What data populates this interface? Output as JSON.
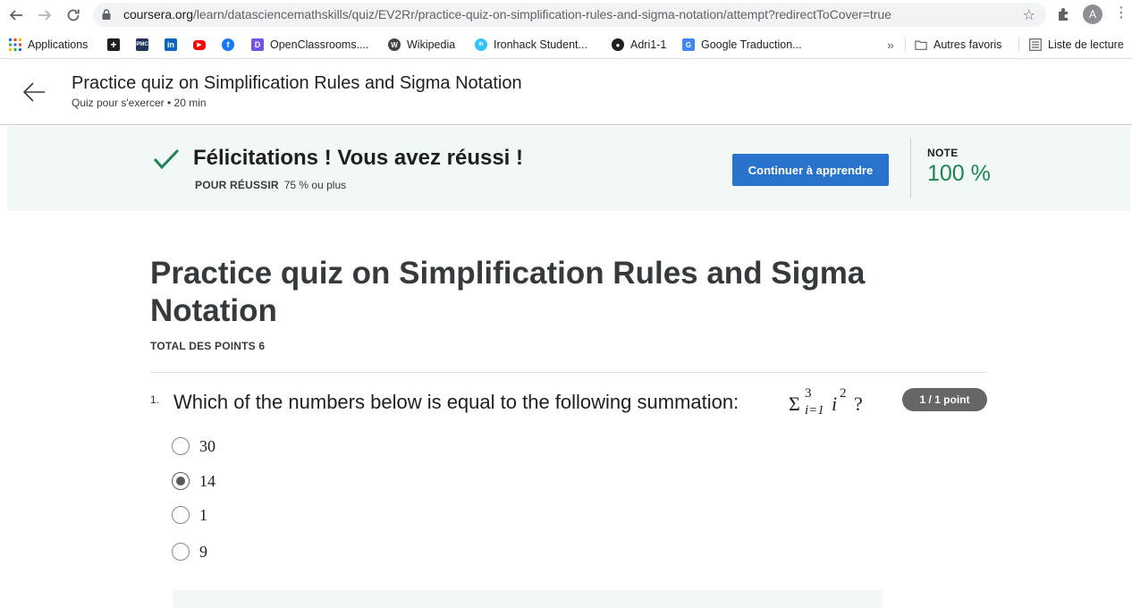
{
  "browser": {
    "url_domain": "coursera.org",
    "url_path": "/learn/datasciencemathskills/quiz/EV2Rr/practice-quiz-on-simplification-rules-and-sigma-notation/attempt?redirectToCover=true",
    "avatar_letter": "A",
    "bookmarks": [
      {
        "label": "Applications",
        "icon": "apps-grid-icon"
      },
      {
        "label": "",
        "icon": "plus-box-icon"
      },
      {
        "label": "",
        "icon": "pmc-icon"
      },
      {
        "label": "",
        "icon": "linkedin-icon"
      },
      {
        "label": "",
        "icon": "youtube-icon"
      },
      {
        "label": "",
        "icon": "facebook-icon"
      },
      {
        "label": "OpenClassrooms....",
        "icon": "openclassrooms-icon"
      },
      {
        "label": "Wikipedia",
        "icon": "wikipedia-icon"
      },
      {
        "label": "Ironhack Student...",
        "icon": "ironhack-icon"
      },
      {
        "label": "Adri1-1",
        "icon": "github-icon"
      },
      {
        "label": "Google Traduction...",
        "icon": "google-translate-icon"
      }
    ],
    "more_bookmarks": "»",
    "other_favorites": "Autres favoris",
    "reading_list": "Liste de lecture"
  },
  "header": {
    "title": "Practice quiz on Simplification Rules and Sigma Notation",
    "subtitle": "Quiz pour s'exercer • 20 min"
  },
  "banner": {
    "congrats": "Félicitations ! Vous avez réussi !",
    "pass_label": "POUR RÉUSSIR",
    "pass_value": "75 % ou plus",
    "continue_label": "Continuer à apprendre",
    "note_label": "NOTE",
    "note_value": "100 %"
  },
  "quiz": {
    "title": "Practice quiz on Simplification Rules and Sigma Notation",
    "total_points": "TOTAL DES POINTS 6",
    "question": {
      "number": "1.",
      "text": "Which of the numbers below is equal to the following summation:",
      "math": {
        "sigma": "Σ",
        "upper": "3",
        "lower": "i=1",
        "var": "i",
        "exp": "2",
        "end": "?"
      },
      "points": "1 / 1 point",
      "options": [
        {
          "label": "30",
          "selected": false
        },
        {
          "label": "14",
          "selected": true
        },
        {
          "label": "1",
          "selected": false
        },
        {
          "label": "9",
          "selected": false
        }
      ]
    }
  },
  "colors": {
    "accent_blue": "#2a73cc",
    "success_green": "#1f8354",
    "banner_bg": "#f2f8f6"
  }
}
